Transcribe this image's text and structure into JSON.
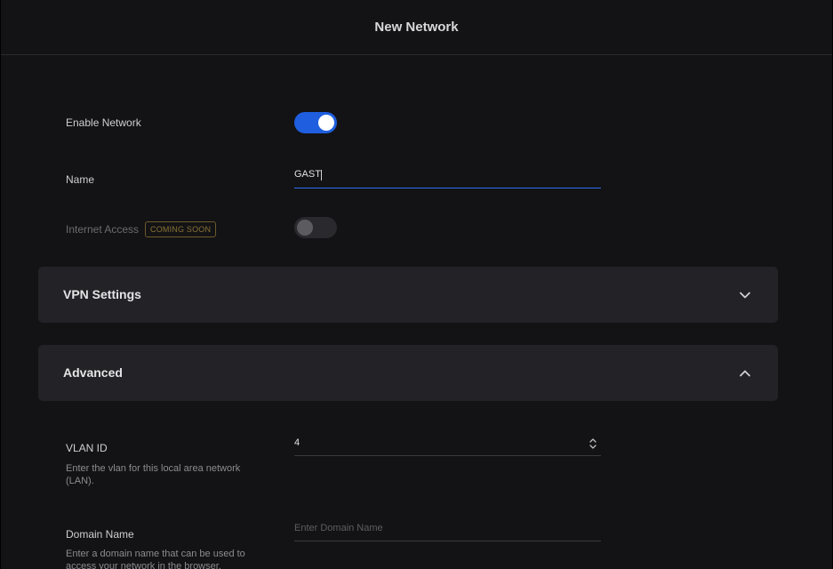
{
  "header": {
    "title": "New Network"
  },
  "form": {
    "enable_network": {
      "label": "Enable Network",
      "enabled": true
    },
    "name": {
      "label": "Name",
      "value": "GAST"
    },
    "internet_access": {
      "label": "Internet Access",
      "badge": "COMING SOON",
      "enabled": false
    }
  },
  "sections": {
    "vpn": {
      "title": "VPN Settings",
      "expanded": false
    },
    "advanced": {
      "title": "Advanced",
      "expanded": true
    }
  },
  "advanced": {
    "vlan_id": {
      "label": "VLAN ID",
      "value": "4",
      "help": "Enter the vlan for this local area network (LAN)."
    },
    "domain_name": {
      "label": "Domain Name",
      "placeholder": "Enter Domain Name",
      "help": "Enter a domain name that can be used to access your network in the browser."
    }
  },
  "colors": {
    "accent": "#1f5fdf",
    "badge": "#8a7333",
    "background": "#131316",
    "section": "#232327"
  },
  "icons": {
    "vpn_chevron": "chevron-down-icon",
    "advanced_chevron": "chevron-up-icon",
    "stepper": "up-down-stepper-icon"
  }
}
